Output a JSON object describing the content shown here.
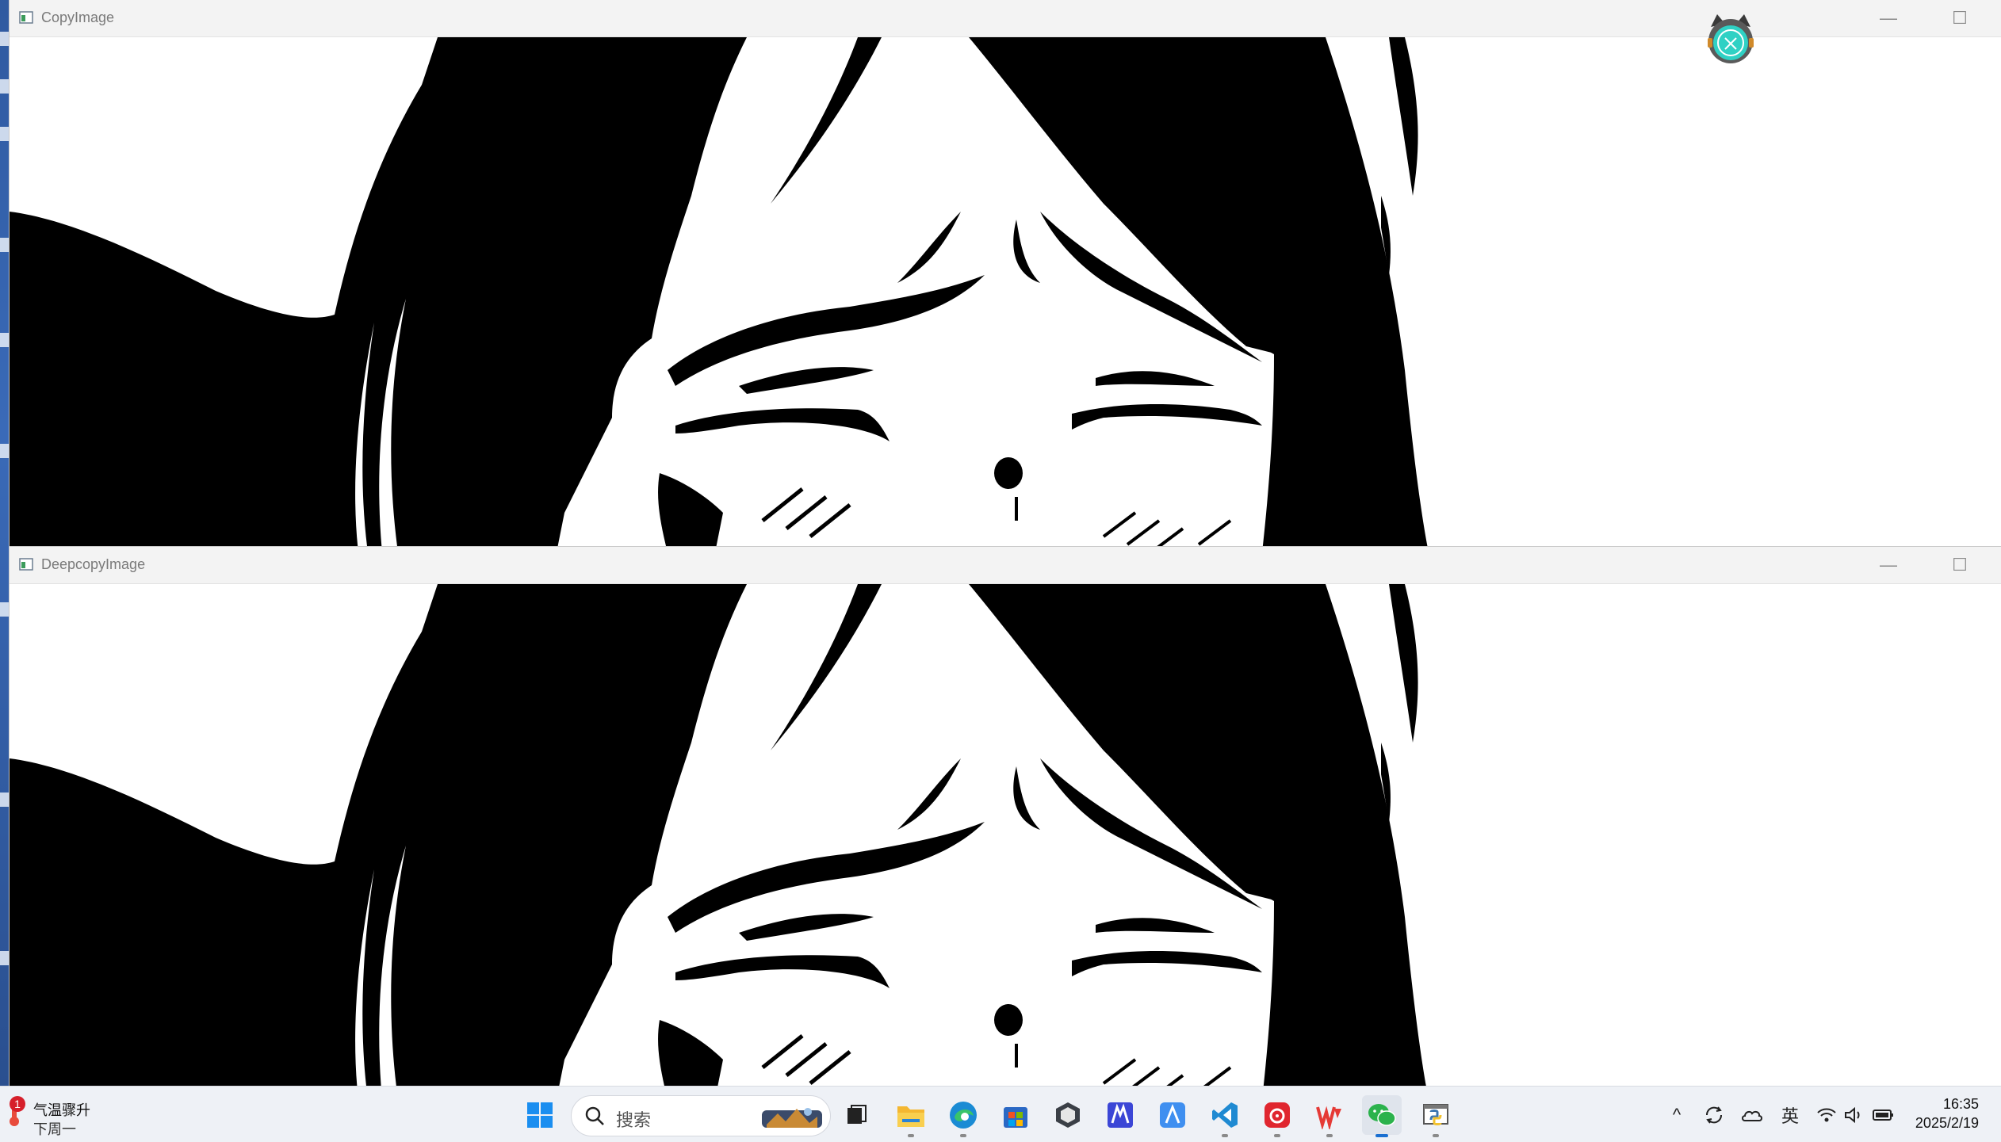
{
  "windows": [
    {
      "title": "CopyImage",
      "minimize_glyph": "—",
      "maximize_glyph": "☐"
    },
    {
      "title": "DeepcopyImage",
      "minimize_glyph": "—",
      "maximize_glyph": "☐"
    }
  ],
  "image_content": "black-and-white thresholded anime face illustration",
  "taskbar": {
    "weather": {
      "line1": "气温骤升",
      "line2": "下周一",
      "badge_count": "1"
    },
    "search_placeholder": "搜索",
    "pinned_apps": [
      {
        "name": "start-icon"
      },
      {
        "name": "task-view-icon"
      },
      {
        "name": "file-explorer-icon"
      },
      {
        "name": "edge-browser-icon"
      },
      {
        "name": "microsoft-store-icon"
      },
      {
        "name": "unity-icon"
      },
      {
        "name": "app-m-icon"
      },
      {
        "name": "app-a-icon"
      },
      {
        "name": "vscode-icon"
      },
      {
        "name": "netease-music-icon"
      },
      {
        "name": "wps-icon"
      },
      {
        "name": "wechat-icon"
      },
      {
        "name": "python-idle-icon"
      }
    ],
    "tray": {
      "chevron": "^",
      "ime": "英"
    },
    "clock": {
      "time": "16:35",
      "date": "2025/2/19"
    }
  },
  "colors": {
    "taskbar_bg": "#eef1f6",
    "titlebar_bg": "#f3f3f3",
    "accent": "#1a6fd1"
  }
}
